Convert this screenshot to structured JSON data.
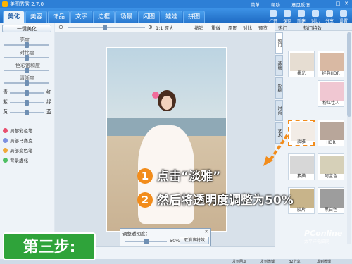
{
  "titlebar": {
    "title": "美图秀秀 2.7.0",
    "links": [
      "菜单",
      "帮助",
      "意见反馈"
    ]
  },
  "tabs": [
    "美化",
    "美容",
    "饰品",
    "文字",
    "边框",
    "场景",
    "闪图",
    "娃娃",
    "拼图"
  ],
  "tools": [
    "打开",
    "保存",
    "新建",
    "对比",
    "分享",
    "设置"
  ],
  "left": {
    "onekey": "一键美化",
    "adjust": [
      "亮度",
      "对比度",
      "色彩饱和度",
      "清晰度"
    ],
    "colors": [
      [
        "青",
        "红"
      ],
      [
        "紫",
        "绿"
      ],
      [
        "黄",
        "蓝"
      ]
    ],
    "effects": [
      "局部彩色笔",
      "局部马赛克",
      "局部变色笔",
      "背景虚化"
    ]
  },
  "zoom": {
    "label": "1:1 原大",
    "actions": [
      "撤销",
      "重做",
      "原图",
      "对比",
      "预览"
    ]
  },
  "dialog": {
    "title": "调整透明度：",
    "value": "50%",
    "button": "取消该特效"
  },
  "right": {
    "head_left": "热门",
    "head_right": "热门特效",
    "vtabs": [
      "热门",
      "基础",
      "影楼",
      "时尚",
      "艺术"
    ],
    "thumbs": [
      "柔光",
      "经典HDR",
      "粉红佳人",
      "淡雅",
      "HDR",
      "素描",
      "阿宝色",
      "胶片",
      "黑白色"
    ]
  },
  "statusbar": {
    "share": "发到朋友",
    "items": [
      "发到微博",
      "B2分享",
      "发到微博"
    ]
  },
  "overlay": {
    "step1_num": "1",
    "step1_text": "点击“淡雅”",
    "step2_num": "2",
    "step2_text": "然后将透明度调整为50%",
    "badge": "第三步:",
    "watermark": "PConline",
    "watermark_sub": "太平洋电脑网"
  }
}
